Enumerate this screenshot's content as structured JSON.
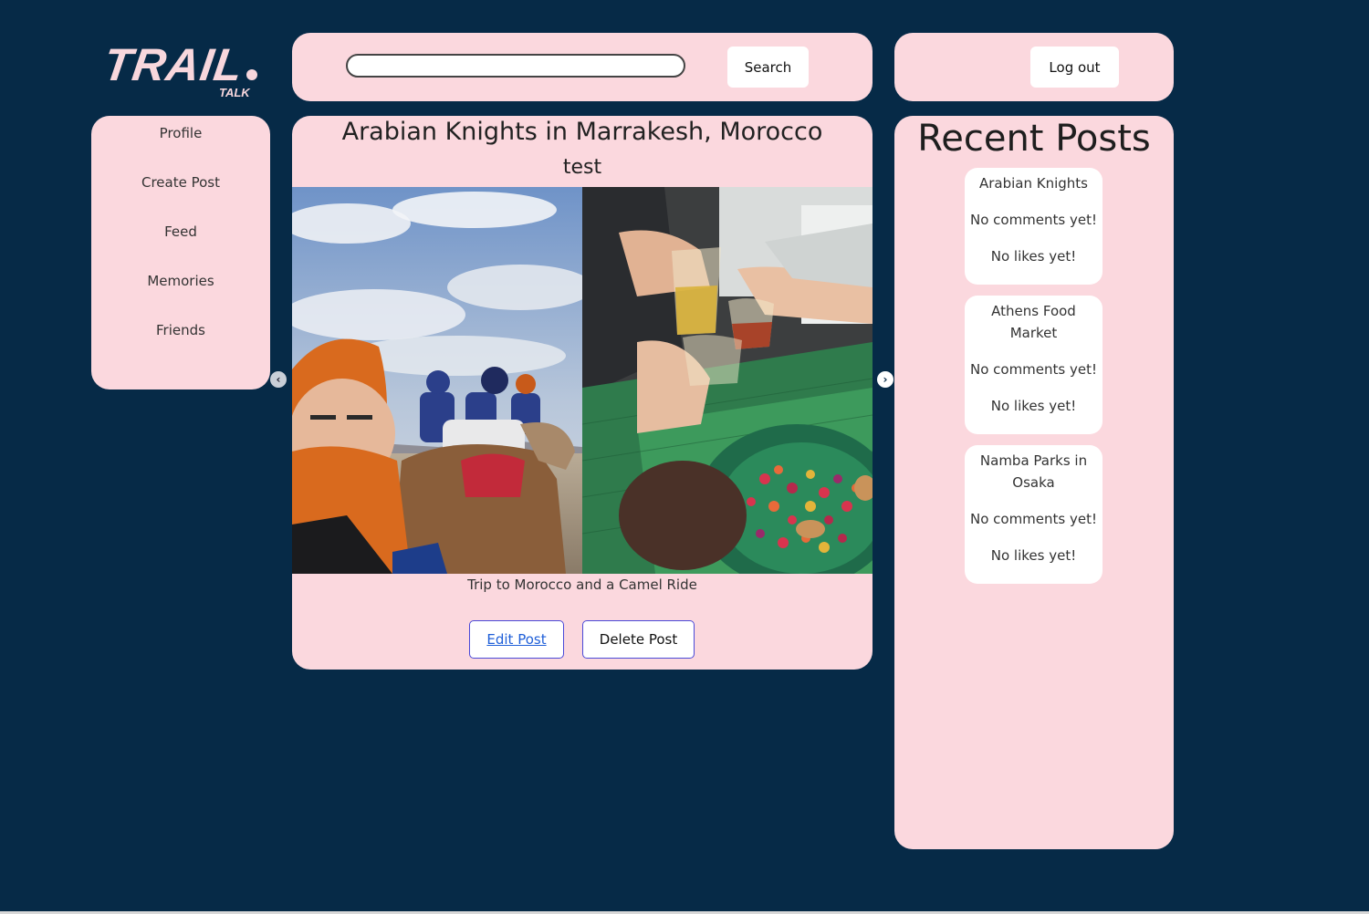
{
  "brand": {
    "logo_main": "TRAIL",
    "logo_sub": "TALK"
  },
  "header": {
    "search_placeholder": "",
    "search_value": "",
    "search_label": "Search",
    "logout_label": "Log out"
  },
  "sidebar": {
    "items": [
      {
        "label": "Profile"
      },
      {
        "label": "Create Post"
      },
      {
        "label": "Feed"
      },
      {
        "label": "Memories"
      },
      {
        "label": "Friends"
      }
    ]
  },
  "post": {
    "title": "Arabian Knights in Marrakesh, Morocco",
    "subtitle": "test",
    "caption": "Trip to Morocco and a Camel Ride",
    "edit_label": "Edit Post",
    "delete_label": "Delete Post",
    "photos": [
      {
        "alt_icon": "camel-ride-photo"
      },
      {
        "alt_icon": "tea-toast-photo"
      }
    ]
  },
  "recent": {
    "title": "Recent Posts",
    "items": [
      {
        "name": "Arabian Knights",
        "comments": "No comments yet!",
        "likes": "No likes yet!"
      },
      {
        "name": "Athens Food Market",
        "comments": "No comments yet!",
        "likes": "No likes yet!"
      },
      {
        "name": "Namba Parks in Osaka",
        "comments": "No comments yet!",
        "likes": "No likes yet!"
      }
    ]
  },
  "colors": {
    "background": "#062a47",
    "panel": "#fbd8de",
    "accent_border": "#4a4ad8",
    "link": "#1f5fd8"
  }
}
